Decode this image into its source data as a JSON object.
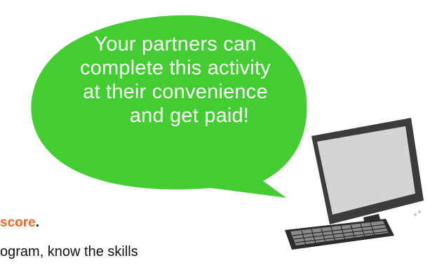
{
  "bubble": {
    "lines": [
      "Your partners can",
      "complete this activity",
      "at their convenience",
      "and get paid!"
    ],
    "fill_color": "#44cc33",
    "text_color": "#ffffff"
  },
  "snippet": {
    "highlight_word": "score",
    "highlight_punct": ".",
    "highlight_color": "#f26522",
    "partial_line": "ogram, know the skills"
  },
  "computer": {
    "icon": "desktop-computer-icon"
  }
}
